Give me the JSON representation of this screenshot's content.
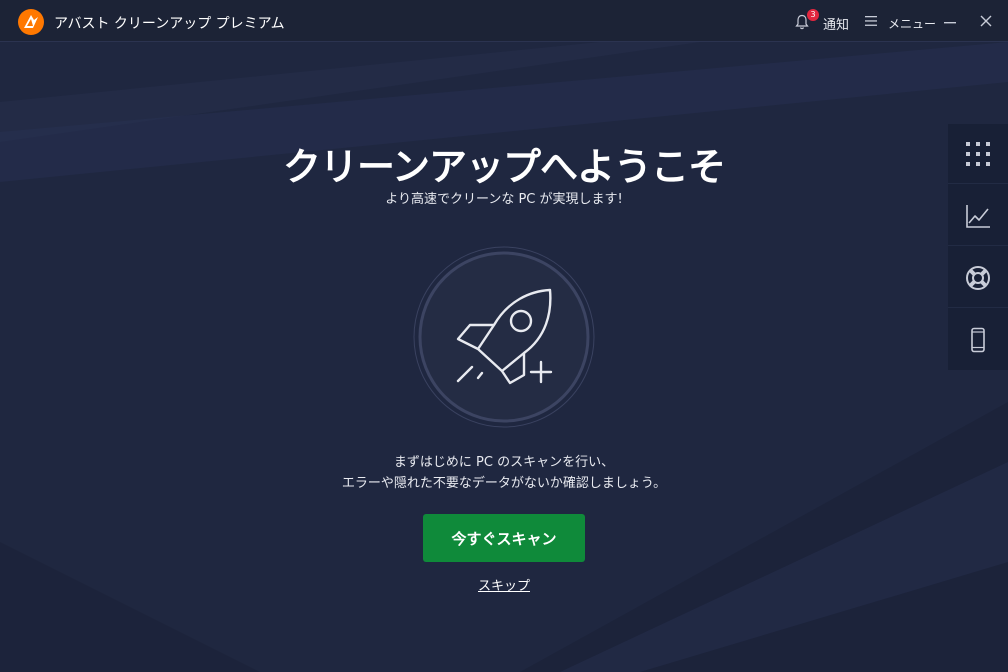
{
  "window": {
    "title": "アバスト クリーンアップ プレミアム",
    "notifications_count": "3",
    "notifications_label": "通知",
    "menu_label": "メニュー"
  },
  "welcome": {
    "heading": "クリーンアップへようこそ",
    "subheading": "より高速でクリーンな PC が実現します!",
    "description_line1": "まずはじめに PC のスキャンを行い、",
    "description_line2": "エラーや隠れた不要なデータがないか確認しましょう。",
    "scan_button": "今すぐスキャン",
    "skip_link": "スキップ"
  },
  "side_panel": {
    "items": [
      {
        "icon": "apps-grid-icon"
      },
      {
        "icon": "performance-chart-icon"
      },
      {
        "icon": "lifebuoy-icon"
      },
      {
        "icon": "mobile-device-icon"
      }
    ]
  },
  "colors": {
    "background": "#1f2740",
    "titlebar": "#1c2336",
    "accent_orange": "#ff7800",
    "scan_button": "#0f8a3a",
    "badge": "#e3263f"
  }
}
